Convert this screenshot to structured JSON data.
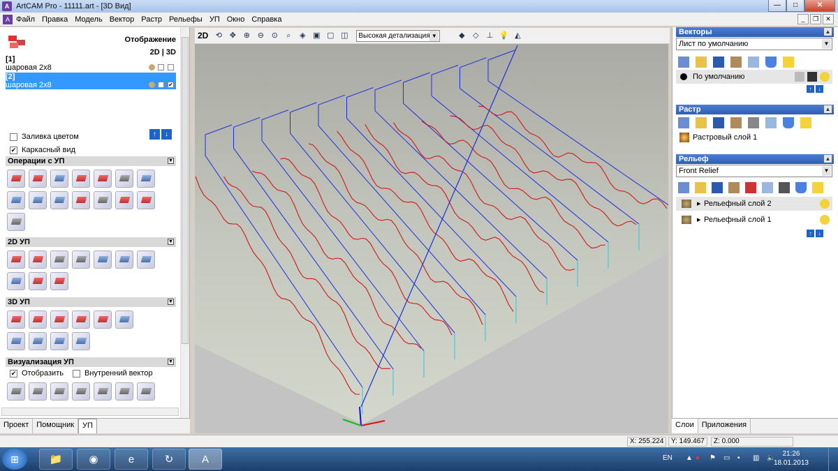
{
  "window": {
    "title": "ArtCAM Pro - 11111.art - [3D Вид]",
    "min": "—",
    "max": "□",
    "close": "✕"
  },
  "menu": [
    "Файл",
    "Правка",
    "Модель",
    "Вектор",
    "Растр",
    "Рельефы",
    "УП",
    "Окно",
    "Справка"
  ],
  "left": {
    "display_label": "Отображение",
    "mode_label": "2D | 3D",
    "toolpaths": [
      {
        "index": "[1]",
        "name": "шаровая 2x8"
      },
      {
        "index": "[2]",
        "name": "шаровая 2x8"
      }
    ],
    "fill_color_label": "Заливка цветом",
    "wireframe_label": "Каркасный вид",
    "sections": {
      "ops": "Операции с УП",
      "up2d": "2D УП",
      "up3d": "3D УП",
      "vis": "Визуализация УП"
    },
    "show_label": "Отобразить",
    "inner_vector_label": "Внутренний вектор",
    "tabs": [
      "Проект",
      "Помощник",
      "УП"
    ]
  },
  "viewtool": {
    "mode_2d": "2D",
    "detail": "Высокая детализация"
  },
  "right": {
    "vectors_title": "Векторы",
    "vector_sheet": "Лист по умолчанию",
    "default_layer": "По умолчанию",
    "raster_title": "Растр",
    "raster_layer": "Растровый слой 1",
    "relief_title": "Рельеф",
    "relief_select": "Front Relief",
    "relief_layers": [
      "Рельефный слой 2",
      "Рельефный слой 1"
    ],
    "tabs": [
      "Слои",
      "Приложения"
    ]
  },
  "status": {
    "x": "X: 255.224",
    "y": "Y: 149.467",
    "z": "Z: 0.000"
  },
  "taskbar": {
    "lang": "EN",
    "time": "21:26",
    "date": "18.01.2013"
  }
}
